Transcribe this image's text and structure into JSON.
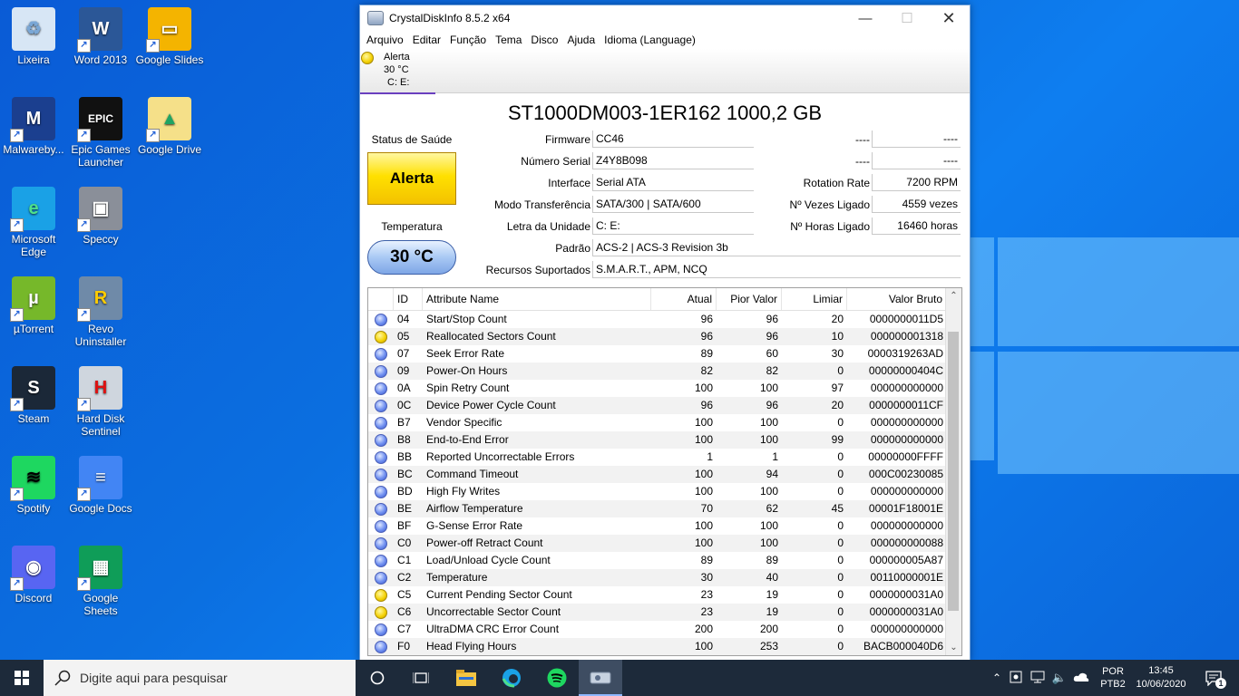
{
  "desktop": {
    "icons": [
      {
        "label": "Lixeira",
        "icon": "recycle-bin-icon"
      },
      {
        "label": "Word 2013",
        "icon": "word-icon"
      },
      {
        "label": "Google Slides",
        "icon": "google-slides-icon"
      },
      {
        "label": "Malwareby...",
        "icon": "malwarebytes-icon"
      },
      {
        "label": "Epic Games Launcher",
        "icon": "epic-games-icon"
      },
      {
        "label": "Google Drive",
        "icon": "google-drive-icon"
      },
      {
        "label": "Microsoft Edge",
        "icon": "edge-icon"
      },
      {
        "label": "Speccy",
        "icon": "speccy-icon"
      },
      {
        "label": "µTorrent",
        "icon": "utorrent-icon"
      },
      {
        "label": "Revo Uninstaller",
        "icon": "revo-icon"
      },
      {
        "label": "Steam",
        "icon": "steam-icon"
      },
      {
        "label": "Hard Disk Sentinel",
        "icon": "hdsentinel-icon"
      },
      {
        "label": "Spotify",
        "icon": "spotify-icon"
      },
      {
        "label": "Google Docs",
        "icon": "google-docs-icon"
      },
      {
        "label": "Discord",
        "icon": "discord-icon"
      },
      {
        "label": "Google Sheets",
        "icon": "google-sheets-icon"
      }
    ]
  },
  "window": {
    "title": "CrystalDiskInfo 8.5.2 x64",
    "menu": [
      "Arquivo",
      "Editar",
      "Função",
      "Tema",
      "Disco",
      "Ajuda",
      "Idioma (Language)"
    ],
    "disk_tab": {
      "status": "Alerta",
      "temp": "30 °C",
      "letters": "C: E:"
    },
    "model": "ST1000DM003-1ER162 1000,2 GB",
    "health_label": "Status de Saúde",
    "health_value": "Alerta",
    "temp_label": "Temperatura",
    "temp_value": "30 °C",
    "info": {
      "firmware_label": "Firmware",
      "firmware": "CC46",
      "serial_label": "Número Serial",
      "serial": "Z4Y8B098",
      "interface_label": "Interface",
      "interface": "Serial ATA",
      "transfer_label": "Modo Transferência",
      "transfer": "SATA/300 | SATA/600",
      "letter_label": "Letra da Unidade",
      "letter": "C: E:",
      "standard_label": "Padrão",
      "standard": "ACS-2 | ACS-3 Revision 3b",
      "features_label": "Recursos Suportados",
      "features": "S.M.A.R.T., APM, NCQ",
      "r1_label": "----",
      "r1_value": "----",
      "r2_label": "----",
      "r2_value": "----",
      "rotation_label": "Rotation Rate",
      "rotation": "7200 RPM",
      "poweron_count_label": "Nº Vezes Ligado",
      "poweron_count": "4559 vezes",
      "poweron_hours_label": "Nº Horas Ligado",
      "poweron_hours": "16460 horas"
    },
    "table": {
      "headers": [
        "ID",
        "Attribute Name",
        "Atual",
        "Pior Valor",
        "Limiar",
        "Valor Bruto"
      ],
      "rows": [
        {
          "status": "blue",
          "id": "04",
          "name": "Start/Stop Count",
          "cur": "96",
          "worst": "96",
          "thr": "20",
          "raw": "0000000011D5"
        },
        {
          "status": "yellow",
          "id": "05",
          "name": "Reallocated Sectors Count",
          "cur": "96",
          "worst": "96",
          "thr": "10",
          "raw": "000000001318"
        },
        {
          "status": "blue",
          "id": "07",
          "name": "Seek Error Rate",
          "cur": "89",
          "worst": "60",
          "thr": "30",
          "raw": "0000319263AD"
        },
        {
          "status": "blue",
          "id": "09",
          "name": "Power-On Hours",
          "cur": "82",
          "worst": "82",
          "thr": "0",
          "raw": "00000000404C"
        },
        {
          "status": "blue",
          "id": "0A",
          "name": "Spin Retry Count",
          "cur": "100",
          "worst": "100",
          "thr": "97",
          "raw": "000000000000"
        },
        {
          "status": "blue",
          "id": "0C",
          "name": "Device Power Cycle Count",
          "cur": "96",
          "worst": "96",
          "thr": "20",
          "raw": "0000000011CF"
        },
        {
          "status": "blue",
          "id": "B7",
          "name": "Vendor Specific",
          "cur": "100",
          "worst": "100",
          "thr": "0",
          "raw": "000000000000"
        },
        {
          "status": "blue",
          "id": "B8",
          "name": "End-to-End Error",
          "cur": "100",
          "worst": "100",
          "thr": "99",
          "raw": "000000000000"
        },
        {
          "status": "blue",
          "id": "BB",
          "name": "Reported Uncorrectable Errors",
          "cur": "1",
          "worst": "1",
          "thr": "0",
          "raw": "00000000FFFF"
        },
        {
          "status": "blue",
          "id": "BC",
          "name": "Command Timeout",
          "cur": "100",
          "worst": "94",
          "thr": "0",
          "raw": "000C00230085"
        },
        {
          "status": "blue",
          "id": "BD",
          "name": "High Fly Writes",
          "cur": "100",
          "worst": "100",
          "thr": "0",
          "raw": "000000000000"
        },
        {
          "status": "blue",
          "id": "BE",
          "name": "Airflow Temperature",
          "cur": "70",
          "worst": "62",
          "thr": "45",
          "raw": "00001F18001E"
        },
        {
          "status": "blue",
          "id": "BF",
          "name": "G-Sense Error Rate",
          "cur": "100",
          "worst": "100",
          "thr": "0",
          "raw": "000000000000"
        },
        {
          "status": "blue",
          "id": "C0",
          "name": "Power-off Retract Count",
          "cur": "100",
          "worst": "100",
          "thr": "0",
          "raw": "000000000088"
        },
        {
          "status": "blue",
          "id": "C1",
          "name": "Load/Unload Cycle Count",
          "cur": "89",
          "worst": "89",
          "thr": "0",
          "raw": "000000005A87"
        },
        {
          "status": "blue",
          "id": "C2",
          "name": "Temperature",
          "cur": "30",
          "worst": "40",
          "thr": "0",
          "raw": "00110000001E"
        },
        {
          "status": "yellow",
          "id": "C5",
          "name": "Current Pending Sector Count",
          "cur": "23",
          "worst": "19",
          "thr": "0",
          "raw": "0000000031A0"
        },
        {
          "status": "yellow",
          "id": "C6",
          "name": "Uncorrectable Sector Count",
          "cur": "23",
          "worst": "19",
          "thr": "0",
          "raw": "0000000031A0"
        },
        {
          "status": "blue",
          "id": "C7",
          "name": "UltraDMA CRC Error Count",
          "cur": "200",
          "worst": "200",
          "thr": "0",
          "raw": "000000000000"
        },
        {
          "status": "blue",
          "id": "F0",
          "name": "Head Flying Hours",
          "cur": "100",
          "worst": "253",
          "thr": "0",
          "raw": "BACB000040D6"
        }
      ]
    }
  },
  "taskbar": {
    "search_placeholder": "Digite aqui para pesquisar",
    "lang1": "POR",
    "lang2": "PTB2",
    "time": "13:45",
    "date": "10/06/2020",
    "notifications": "1"
  }
}
